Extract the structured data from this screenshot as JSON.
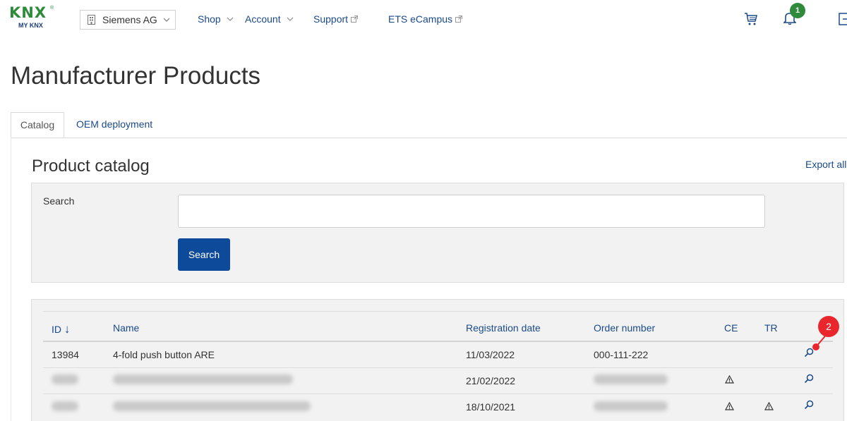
{
  "header": {
    "logo_text": "KNX",
    "logo_sub": "MY KNX",
    "company": "Siemens AG",
    "nav": [
      {
        "label": "Shop"
      },
      {
        "label": "Account"
      },
      {
        "label": "Support"
      },
      {
        "label": "ETS eCampus"
      }
    ],
    "notification_count": "1"
  },
  "page": {
    "title": "Manufacturer Products",
    "tabs": [
      {
        "label": "Catalog"
      },
      {
        "label": "OEM deployment"
      }
    ]
  },
  "catalog": {
    "title": "Product catalog",
    "export_label": "Export all",
    "search_label": "Search",
    "search_value": "",
    "search_button": "Search"
  },
  "table": {
    "columns": [
      "ID",
      "Name",
      "Registration date",
      "Order number",
      "CE",
      "TR"
    ],
    "sort_indicator": "↓",
    "rows": [
      {
        "id": "13984",
        "name": "4-fold push button ARE",
        "date": "11/03/2022",
        "order": "000-111-222",
        "ce": false,
        "tr": false
      },
      {
        "id": "",
        "name": "",
        "date": "21/02/2022",
        "order": "",
        "ce": true,
        "tr": false
      },
      {
        "id": "",
        "name": "",
        "date": "18/10/2021",
        "order": "",
        "ce": true,
        "tr": true
      }
    ]
  },
  "annotation": {
    "label": "2"
  },
  "colors": {
    "brand_green": "#2e8b3b",
    "link_blue": "#1a4a8a",
    "primary_button": "#0d4a9a",
    "callout_red": "#e8262b"
  }
}
